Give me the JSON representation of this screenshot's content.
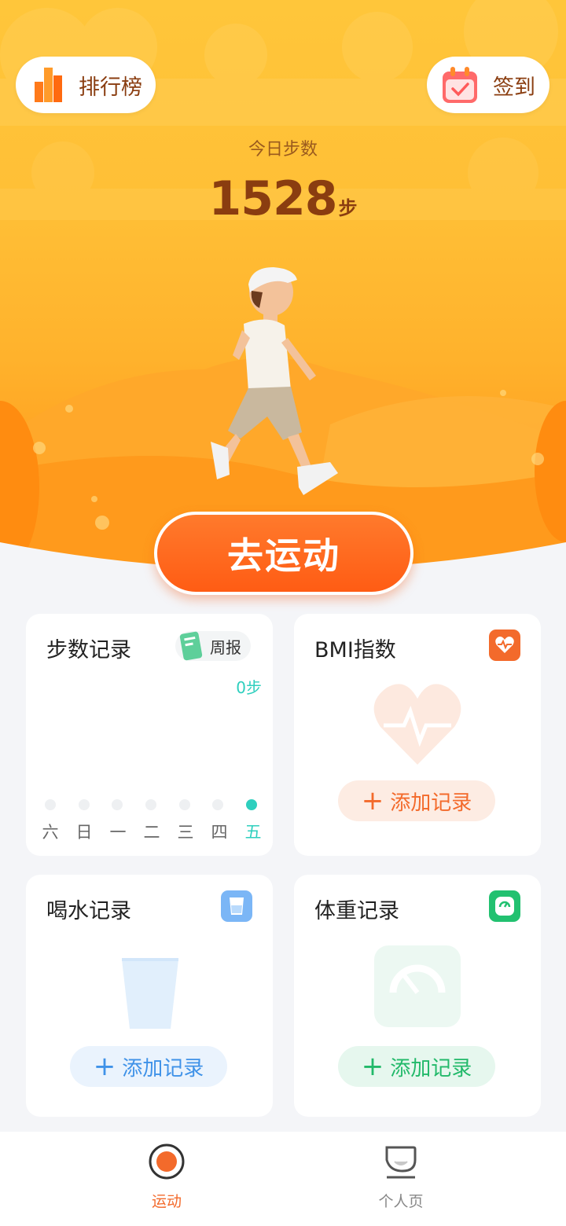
{
  "header": {
    "leaderboard_label": "排行榜",
    "checkin_label": "签到",
    "today_label": "今日步数",
    "step_count": "1528",
    "step_unit": "步"
  },
  "main_action": {
    "label": "去运动"
  },
  "cards": {
    "steps": {
      "title": "步数记录",
      "weekly_label": "周报",
      "value_label": "0步",
      "days": [
        "六",
        "日",
        "一",
        "二",
        "三",
        "四",
        "五"
      ],
      "active_day_index": 6
    },
    "bmi": {
      "title": "BMI指数",
      "add_label": "添加记录",
      "icon": "heart-pulse-icon",
      "accent": "#f36a2b"
    },
    "water": {
      "title": "喝水记录",
      "add_label": "添加记录",
      "icon": "cup-icon",
      "accent": "#4a9df0"
    },
    "weight": {
      "title": "体重记录",
      "add_label": "添加记录",
      "icon": "scale-icon",
      "accent": "#22c170"
    }
  },
  "tabbar": {
    "items": [
      {
        "label": "运动",
        "icon": "record-icon",
        "active": true
      },
      {
        "label": "个人页",
        "icon": "profile-icon",
        "active": false
      }
    ],
    "active_color": "#f36a2b",
    "inactive_color": "#888888"
  }
}
